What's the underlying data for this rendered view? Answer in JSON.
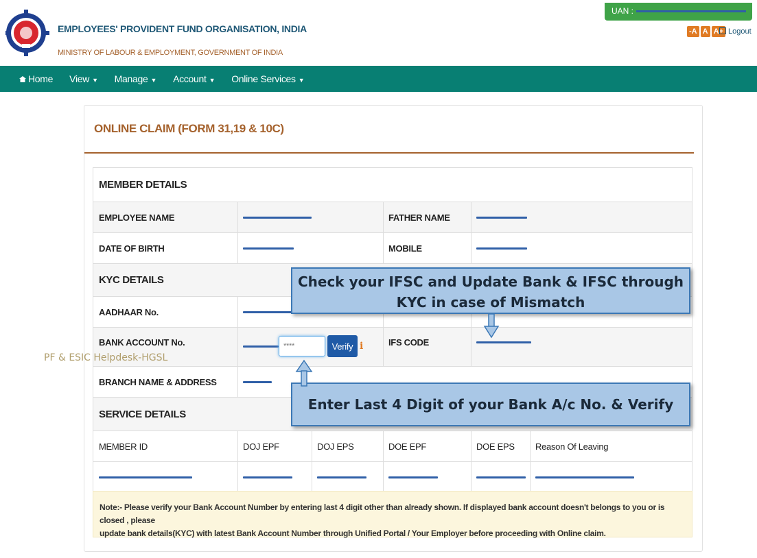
{
  "header": {
    "org_name": "EMPLOYEES' PROVIDENT FUND ORGANISATION, INDIA",
    "ministry": "MINISTRY OF LABOUR & EMPLOYMENT, GOVERNMENT OF INDIA",
    "uan_label": "UAN :",
    "font_size_buttons": [
      "-A",
      "A",
      "A+"
    ],
    "logout_label": "Logout"
  },
  "nav": {
    "items": [
      {
        "label": "Home",
        "icon": "home-icon"
      },
      {
        "label": "View",
        "icon": "caret-down-icon"
      },
      {
        "label": "Manage",
        "icon": "caret-down-icon"
      },
      {
        "label": "Account",
        "icon": "caret-down-icon"
      },
      {
        "label": "Online Services",
        "icon": "caret-down-icon"
      }
    ]
  },
  "page": {
    "title": "ONLINE CLAIM (FORM 31,19 & 10C)"
  },
  "member_details": {
    "heading": "MEMBER DETAILS",
    "employee_name_label": "EMPLOYEE NAME",
    "father_name_label": "FATHER NAME",
    "dob_label": "DATE OF BIRTH",
    "mobile_label": "MOBILE"
  },
  "kyc_details": {
    "heading": "KYC DETAILS",
    "aadhaar_label": "AADHAAR No.",
    "bank_account_label": "BANK ACCOUNT No.",
    "account_input_value": "****",
    "verify_label": "Verify",
    "ifs_code_label": "IFS CODE",
    "branch_label": "BRANCH NAME & ADDRESS"
  },
  "service_details": {
    "heading": "SERVICE DETAILS",
    "columns": [
      "MEMBER ID",
      "DOJ EPF",
      "DOJ EPS",
      "DOE EPF",
      "DOE EPS",
      "Reason Of Leaving"
    ]
  },
  "note": {
    "line1": "Note:- Please verify your Bank Account Number by entering last 4 digit other than already shown. If displayed bank account doesn't belongs to you or is closed , please",
    "line2": "update bank details(KYC) with latest Bank Account Number through Unified Portal / Your Employer before proceeding with Online claim."
  },
  "annotations": {
    "callout_ifsc_line1": "Check your IFSC and Update Bank & IFSC through",
    "callout_ifsc_line2": "KYC in case of Mismatch",
    "callout_verify": "Enter Last 4 Digit of your Bank A/c No. & Verify",
    "watermark": "PF & ESIC Helpdesk-HGSL"
  },
  "colors": {
    "nav_bg": "#087f73",
    "title_accent": "#a5622d",
    "uan_badge": "#3fa348",
    "verify_button": "#1f5aa6",
    "callout_fill": "#a9c7e6",
    "redaction": "#2f5fa7"
  }
}
